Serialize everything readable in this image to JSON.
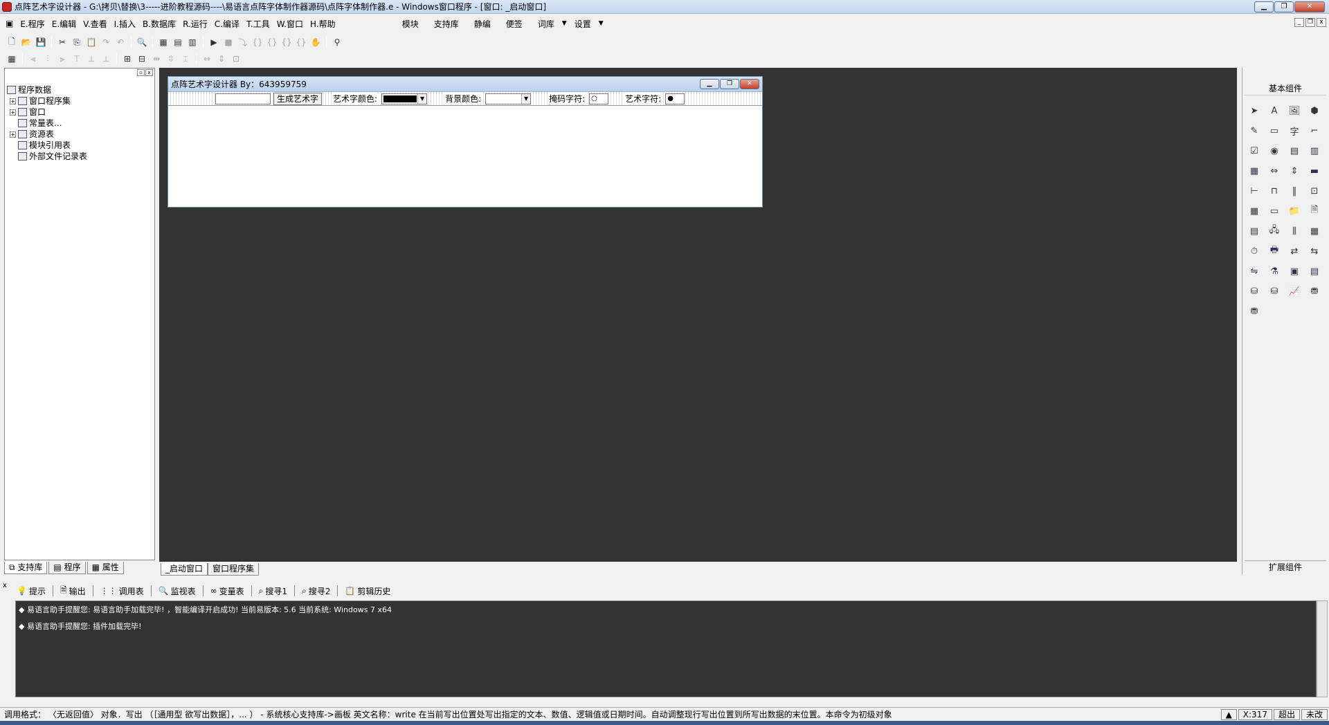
{
  "window": {
    "title": "点阵艺术字设计器 - G:\\拷贝\\替换\\3-----进阶教程源码----\\易语言点阵字体制作器源码\\点阵字体制作器.e - Windows窗口程序 - [窗口: _启动窗口]"
  },
  "menu": {
    "items": [
      "E.程序",
      "E.编辑",
      "V.查看",
      "I.插入",
      "B.数据库",
      "R.运行",
      "C.编译",
      "T.工具",
      "W.窗口",
      "H.帮助"
    ],
    "extra": [
      "模块",
      "支持库",
      "静编",
      "便签",
      "词库",
      "设置"
    ]
  },
  "tree": {
    "root": "程序数据",
    "items": [
      "窗口程序集",
      "窗口",
      "常量表...",
      "资源表",
      "模块引用表",
      "外部文件记录表"
    ]
  },
  "left_tabs": [
    "支持库",
    "程序",
    "属性"
  ],
  "design_window": {
    "title": "点阵艺术字设计器 By：643959759",
    "generate_button": "生成艺术字",
    "art_color_label": "艺术字颜色:",
    "bg_color_label": "背景颜色:",
    "mask_char_label": "掩码字符:",
    "mask_char_value": "○",
    "art_char_label": "艺术字符:",
    "art_char_value": "●",
    "art_color": "#000000",
    "bg_color": "#ffffff"
  },
  "canvas_tabs": [
    "_启动窗口",
    "窗口程序集"
  ],
  "right_panel": {
    "title": "基本组件",
    "bottom": "扩展组件"
  },
  "bottom_tabs": [
    "提示",
    "输出",
    "调用表",
    "监视表",
    "变量表",
    "搜寻1",
    "搜寻2",
    "剪辑历史"
  ],
  "output_lines": [
    "◆ 易语言助手提醒您: 易语言助手加载完毕!  ，智能编译开启成功!  当前易版本: 5.6  当前系统: Windows 7 x64",
    "◆ 易语言助手提醒您: 插件加载完毕!"
  ],
  "status": {
    "text": "调用格式： 〈无返回值〉 对象．写出 （［通用型 欲写出数据］，... ） - 系统核心支持库->画板    英文名称：write    在当前写出位置处写出指定的文本、数值、逻辑值或日期时间。自动调整现行写出位置到所写出数据的末位置。本命令为初级对象",
    "x": "X:317",
    "mode": "超出",
    "end": "未改"
  }
}
